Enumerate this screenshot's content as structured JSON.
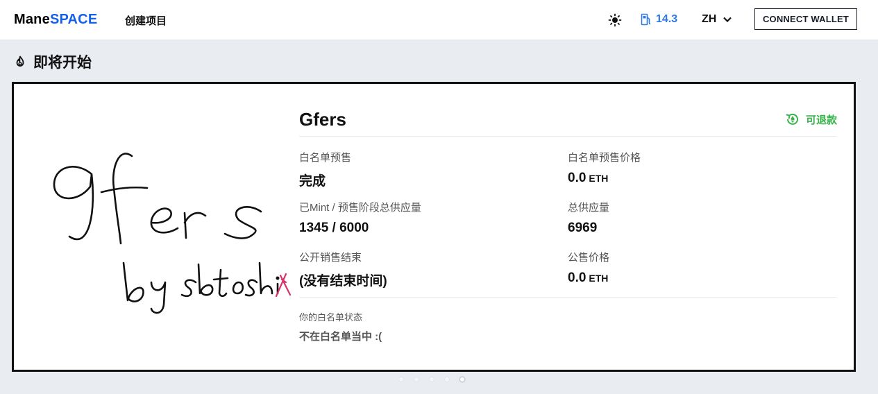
{
  "header": {
    "logo_part1": "Mane",
    "logo_part2": "SPACE",
    "nav_create": "创建项目",
    "gas_value": "14.3",
    "language": "ZH",
    "connect_wallet": "CONNECT WALLET",
    "icons": [
      "sun-icon",
      "gas-pump-icon",
      "chevron-down-icon"
    ]
  },
  "section": {
    "title": "即将开始",
    "icon": "flame-icon"
  },
  "card": {
    "project_name": "Gfers",
    "refund_label": "可退款",
    "refund_icon": "refund-icon",
    "whitelist_presale_label": "白名单预售",
    "whitelist_presale_value": "完成",
    "whitelist_price_label": "白名单预售价格",
    "whitelist_price_value": "0.0",
    "whitelist_price_unit": "ETH",
    "minted_label": "已Mint / 预售阶段总供应量",
    "minted_value": "1345 / 6000",
    "total_supply_label": "总供应量",
    "total_supply_value": "6969",
    "public_end_label": "公开销售结束",
    "public_end_value": "(没有结束时间)",
    "public_price_label": "公售价格",
    "public_price_value": "0.0",
    "public_price_unit": "ETH",
    "wl_status_label": "你的白名单状态",
    "wl_status_value": "不在白名单当中 :("
  },
  "carousel": {
    "count": 5,
    "active_index": 4
  },
  "colors": {
    "brand_blue": "#1560e8",
    "gas_blue": "#2e7ae6",
    "refund_green": "#37b24d",
    "page_bg": "#e9ecf1",
    "accent_pink": "#d6336c"
  }
}
